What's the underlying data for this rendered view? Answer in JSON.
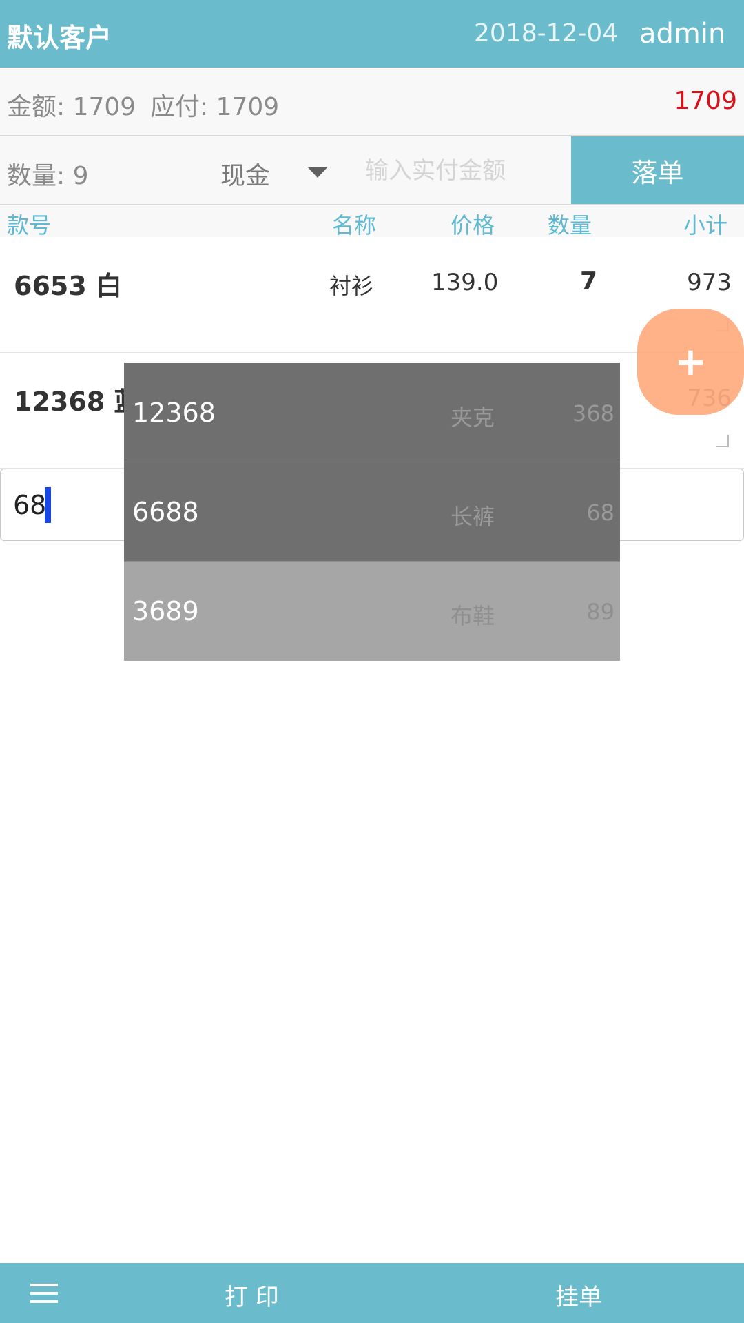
{
  "header": {
    "customer": "默认客户",
    "date": "2018-12-04",
    "user": "admin"
  },
  "summary": {
    "amount_label": "金额: 1709",
    "payable_label": "应付: 1709",
    "total": "1709"
  },
  "order_bar": {
    "quantity_label": "数量: 9",
    "payment_method": "现金",
    "paid_placeholder": "输入实付金额",
    "submit_label": "落单"
  },
  "columns": {
    "code": "款号",
    "name": "名称",
    "price": "价格",
    "qty": "数量",
    "subtotal": "小计"
  },
  "items": [
    {
      "code": "6653 白",
      "name": "衬衫",
      "price": "139.0",
      "qty": "7",
      "subtotal": "973"
    },
    {
      "code": "12368 蓝",
      "name": "",
      "price": "",
      "qty": "",
      "subtotal": "736"
    }
  ],
  "search": {
    "value": "68"
  },
  "fab": {
    "label": "+"
  },
  "suggestions": [
    {
      "code": "12368",
      "name": "夹克",
      "price": "368"
    },
    {
      "code": "6688",
      "name": "长裤",
      "price": "68"
    },
    {
      "code": "3689",
      "name": "布鞋",
      "price": "89"
    }
  ],
  "bottom": {
    "print_label": "打 印",
    "hold_label": "挂单"
  },
  "colors": {
    "primary": "#6abccc",
    "total_red": "#d9121a",
    "fab": "#ffab7d",
    "cursor": "#1a46e6"
  }
}
